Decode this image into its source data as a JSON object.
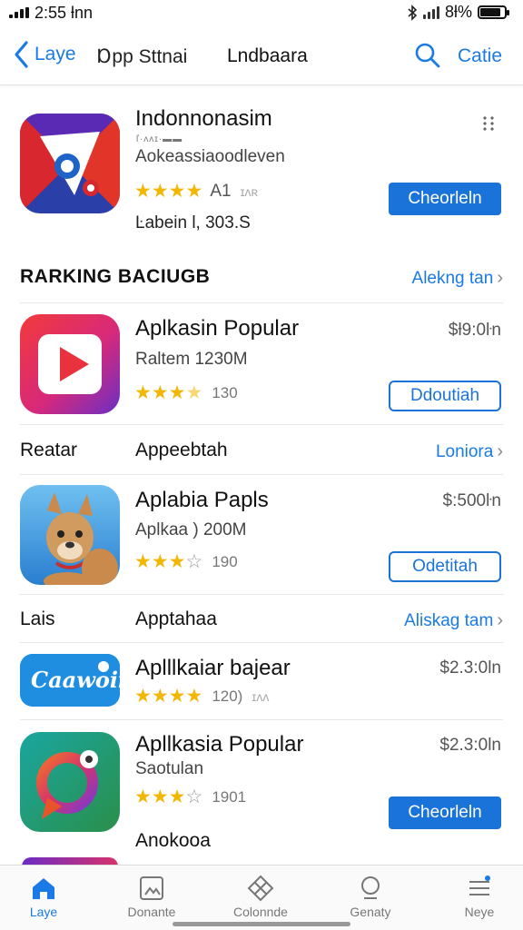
{
  "status_bar": {
    "time": "2:55 ƚnn",
    "battery": "8ƚ%",
    "battery_level": 0.85
  },
  "nav": {
    "back_label": "Laye",
    "segment_label": "Ɒpp Sttnai",
    "title": "Lndbaara",
    "action_label": "Catie"
  },
  "featured": {
    "title": "Indonnonasim",
    "small_line": "ľ·ʌʌɪ·▬▬",
    "subtitle": "Aokeassiaoodleven",
    "rating_stars": 4,
    "rating_text": "A1",
    "rating_extra": "ɪʌʀ",
    "meta": "Ŀabein Ɩ, 303.S",
    "button_label": "Cheorleln"
  },
  "section1": {
    "title": "RARKING  BACIUGB",
    "link_label": "Alekng tan"
  },
  "app1": {
    "title": "Aplkasin Popular",
    "subtitle": "Raltem 1230M",
    "price": "$ƚ9:0ŀn",
    "rating_stars": 3.5,
    "rating_count": "130",
    "button_label": "Ddoutiah"
  },
  "row1": {
    "label": "Reatar",
    "middle": "Appeebtah",
    "link_label": "Loniora"
  },
  "app2": {
    "title": "Aplabia Papls",
    "subtitle": "Aplkaa ) 200M",
    "price": "$:500ŀn",
    "rating_stars": 3,
    "rating_count": "190",
    "button_label": "Odetitah"
  },
  "row2": {
    "label": "Lais",
    "middle": "Apptahaa",
    "link_label": "Aliskag tam"
  },
  "app3": {
    "title": "Aplllkaiar bajear",
    "icon_text": "Caawoii",
    "price": "$2.3:0ln",
    "rating_stars": 4,
    "rating_count": "120)",
    "rating_extra": "ɪʌʌ"
  },
  "app4": {
    "title": "Apllkasia Popular",
    "subtitle": "Saotulan",
    "price": "$2.3:0ln",
    "rating_stars": 3,
    "rating_count": "1901",
    "button_label": "Cheorleln",
    "footer": "Anokooa"
  },
  "tabs": [
    {
      "label": "Laye",
      "icon": "home-icon",
      "active": true
    },
    {
      "label": "Donante",
      "icon": "image-icon",
      "active": false
    },
    {
      "label": "Colonnde",
      "icon": "box-x-icon",
      "active": false
    },
    {
      "label": "Genaty",
      "icon": "search-icon",
      "active": false
    },
    {
      "label": "Neye",
      "icon": "menu-icon",
      "active": false
    }
  ],
  "colors": {
    "accent": "#1a7ae6",
    "button": "#1a73d9",
    "star": "#f2b705"
  }
}
